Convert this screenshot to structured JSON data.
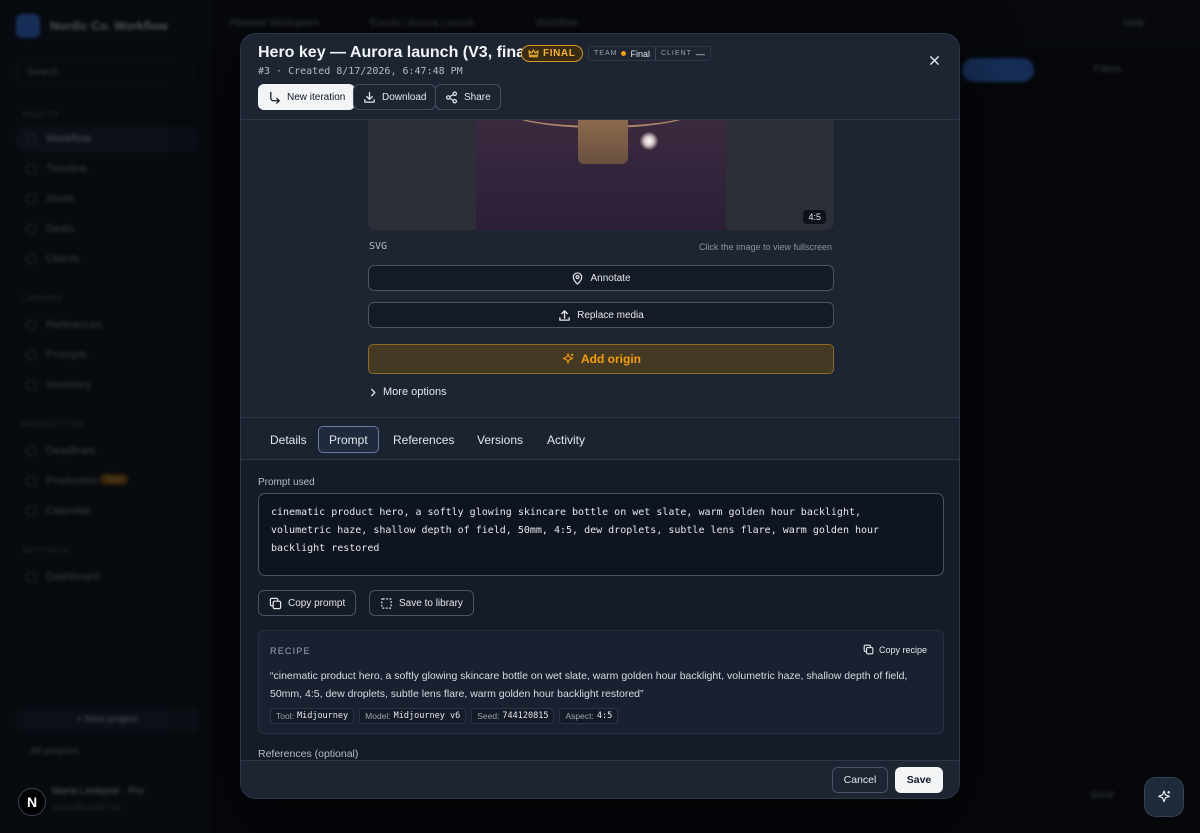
{
  "background": {
    "brand": "Nordic Co. Workflow",
    "search": "Search",
    "groups": [
      "Assets",
      "Library",
      "Production",
      "Settings"
    ],
    "nav": [
      {
        "label": "Workflow",
        "active": true
      },
      {
        "label": "Timeline"
      },
      {
        "label": "Shots"
      },
      {
        "label": "Deals"
      },
      {
        "label": "Clients"
      },
      {
        "label": "References"
      },
      {
        "label": "Prompts"
      },
      {
        "label": "Inventory"
      },
      {
        "label": "Deadlines"
      },
      {
        "label": "Production"
      },
      {
        "label": "Calendar"
      },
      {
        "label": "Dashboard"
      }
    ],
    "new_badge": "New",
    "invite": "+ New project",
    "project": "All projects",
    "user_name": "Maria Lindqvist · Pro",
    "user_email": "maria@nordic.co",
    "breadcrumbs": [
      "Planned Workspace",
      "Events / Aurora Launch",
      "Workflow"
    ],
    "help": "Help",
    "right_label": "Filters",
    "send": "Send"
  },
  "modal": {
    "title": "Hero key — Aurora launch (V3, final)",
    "badge": "FINAL",
    "team_label": "TEAM",
    "team_value": "Final",
    "client_label": "CLIENT",
    "client_value": "—",
    "subtitle": "#3 · Created 8/17/2026, 6:47:48 PM",
    "actions": {
      "new_iteration": "New iteration",
      "download": "Download",
      "share": "Share"
    },
    "preview": {
      "ratio": "4:5",
      "format": "SVG",
      "hint": "Click the image to view fullscreen"
    },
    "annotate": "Annotate",
    "replace": "Replace media",
    "add_origin": "Add origin",
    "more_options": "More options",
    "tabs": [
      "Details",
      "Prompt",
      "References",
      "Versions",
      "Activity"
    ],
    "active_tab": "Prompt",
    "prompt_label": "Prompt used",
    "prompt_lines": [
      "cinematic product hero, a softly glowing skincare bottle on wet slate, warm golden hour backlight,",
      "volumetric haze, shallow depth of field, 50mm, 4:5, dew droplets, subtle lens flare, warm golden hour",
      "backlight restored"
    ],
    "copy_prompt": "Copy prompt",
    "save_library": "Save to library",
    "recipe": {
      "label": "RECIPE",
      "copy": "Copy recipe",
      "text": "“cinematic product hero, a softly glowing skincare bottle on wet slate, warm golden hour backlight, volumetric haze, shallow depth of field, 50mm, 4:5, dew droplets, subtle lens flare, warm golden hour backlight restored”",
      "chips": [
        {
          "k": "Tool:",
          "v": "Midjourney"
        },
        {
          "k": "Model:",
          "v": "Midjourney v6"
        },
        {
          "k": "Seed:",
          "v": "744120815"
        },
        {
          "k": "Aspect:",
          "v": "4:5"
        }
      ]
    },
    "references_label": "References (optional)",
    "cancel": "Cancel",
    "save": "Save"
  },
  "avatar_letter": "N",
  "colors": {
    "accent": "#f5b23a",
    "origin": "#f59e0b",
    "primary": "#f3f4f6",
    "modal_bg": "#1d2532"
  }
}
